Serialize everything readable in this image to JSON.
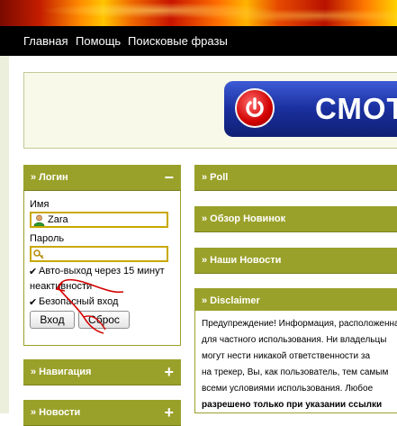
{
  "nav": {
    "items": [
      "Главная",
      "Помощь",
      "Поисковые фразы"
    ]
  },
  "banner": {
    "ad_text": "СМОТ"
  },
  "login": {
    "title": "» Логин",
    "toggle": "−",
    "username_label": "Имя",
    "username_value": "Zara",
    "password_label": "Пароль",
    "auto_logout_text": "Авто-выход через 15 минут",
    "auto_logout_text2": "неактивности",
    "secure_login_text": "Безопасный вход",
    "login_button": "Вход",
    "reset_button": "Сброс"
  },
  "left_panels": [
    {
      "title": "» Навигация",
      "toggle": "+"
    },
    {
      "title": "» Новости",
      "toggle": "+"
    }
  ],
  "right_panels": [
    {
      "title": "» Poll"
    },
    {
      "title": "» Обзор Новинок"
    },
    {
      "title": "» Наши Новости"
    },
    {
      "title": "» Disclaimer"
    }
  ],
  "disclaimer": {
    "lines": [
      "Предупреждение! Информация, расположенная",
      "для частного использования. Ни владельцы",
      "могут нести никакой ответственности за",
      "на трекер, Вы, как пользователь, тем самым",
      "всеми условиями использования. Любое",
      "разрешено только при указании ссылки"
    ]
  },
  "colors": {
    "panel_header": "#9aa12a",
    "field_border": "#c8a800",
    "annotation": "#d40000"
  }
}
